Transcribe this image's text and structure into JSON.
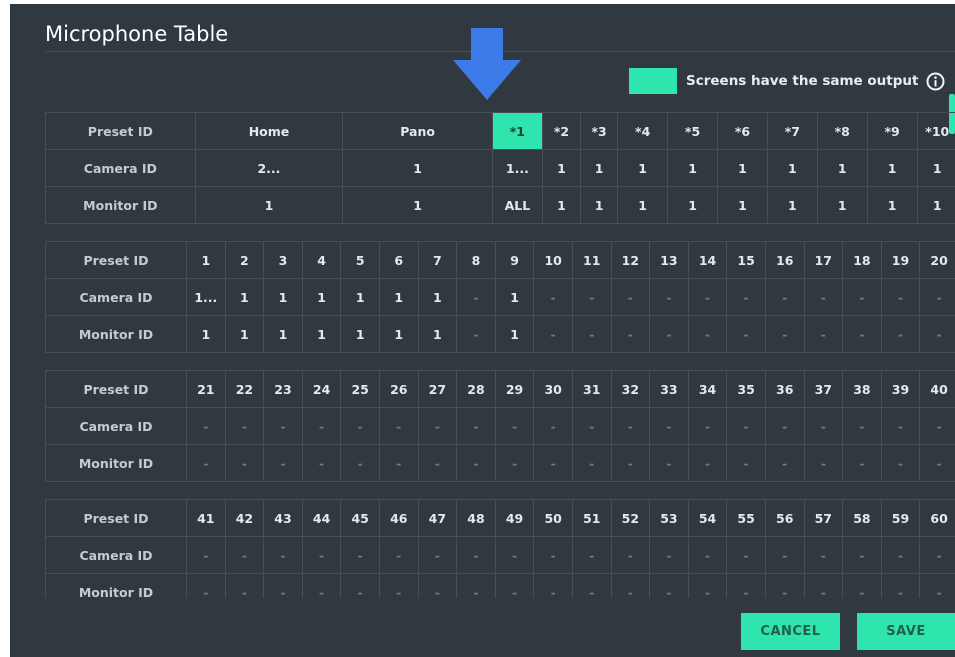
{
  "title": "Microphone Table",
  "legend": {
    "label": "Screens have the same output",
    "swatch_color": "#2ee5ad",
    "icon": "info-icon"
  },
  "colors": {
    "accent": "#2ee5ad",
    "panel": "#303840",
    "arrow": "#3d7be8"
  },
  "tables": [
    {
      "columns": 13,
      "widths": [
        1.9,
        1.88,
        1.88,
        0.62,
        0.47,
        0.47,
        0.62,
        0.62,
        0.62,
        0.62,
        0.62,
        0.62,
        0.52
      ],
      "preset": [
        "Home",
        "Pano",
        "*1",
        "*2",
        "*3",
        "*4",
        "*5",
        "*6",
        "*7",
        "*8",
        "*9",
        "*10"
      ],
      "camera": [
        "2...",
        "1",
        "1...",
        "1",
        "1",
        "1",
        "1",
        "1",
        "1",
        "1",
        "1",
        "1"
      ],
      "monitor": [
        "1",
        "1",
        "ALL",
        "1",
        "1",
        "1",
        "1",
        "1",
        "1",
        "1",
        "1",
        "1"
      ],
      "selected_index": 2
    },
    {
      "columns": 21,
      "preset": [
        "1",
        "2",
        "3",
        "4",
        "5",
        "6",
        "7",
        "8",
        "9",
        "10",
        "11",
        "12",
        "13",
        "14",
        "15",
        "16",
        "17",
        "18",
        "19",
        "20"
      ],
      "camera": [
        "1...",
        "1",
        "1",
        "1",
        "1",
        "1",
        "1",
        "-",
        "1",
        "-",
        "-",
        "-",
        "-",
        "-",
        "-",
        "-",
        "-",
        "-",
        "-",
        "-"
      ],
      "monitor": [
        "1",
        "1",
        "1",
        "1",
        "1",
        "1",
        "1",
        "-",
        "1",
        "-",
        "-",
        "-",
        "-",
        "-",
        "-",
        "-",
        "-",
        "-",
        "-",
        "-"
      ]
    },
    {
      "columns": 21,
      "preset": [
        "21",
        "22",
        "23",
        "24",
        "25",
        "26",
        "27",
        "28",
        "29",
        "30",
        "31",
        "32",
        "33",
        "34",
        "35",
        "36",
        "37",
        "38",
        "39",
        "40"
      ],
      "camera": [
        "-",
        "-",
        "-",
        "-",
        "-",
        "-",
        "-",
        "-",
        "-",
        "-",
        "-",
        "-",
        "-",
        "-",
        "-",
        "-",
        "-",
        "-",
        "-",
        "-"
      ],
      "monitor": [
        "-",
        "-",
        "-",
        "-",
        "-",
        "-",
        "-",
        "-",
        "-",
        "-",
        "-",
        "-",
        "-",
        "-",
        "-",
        "-",
        "-",
        "-",
        "-",
        "-"
      ]
    },
    {
      "columns": 21,
      "preset": [
        "41",
        "42",
        "43",
        "44",
        "45",
        "46",
        "47",
        "48",
        "49",
        "50",
        "51",
        "52",
        "53",
        "54",
        "55",
        "56",
        "57",
        "58",
        "59",
        "60"
      ],
      "camera": [
        "-",
        "-",
        "-",
        "-",
        "-",
        "-",
        "-",
        "-",
        "-",
        "-",
        "-",
        "-",
        "-",
        "-",
        "-",
        "-",
        "-",
        "-",
        "-",
        "-"
      ],
      "monitor": [
        "-",
        "-",
        "-",
        "-",
        "-",
        "-",
        "-",
        "-",
        "-",
        "-",
        "-",
        "-",
        "-",
        "-",
        "-",
        "-",
        "-",
        "-",
        "-",
        "-"
      ]
    }
  ],
  "row_labels": {
    "preset": "Preset ID",
    "camera": "Camera ID",
    "monitor": "Monitor ID"
  },
  "buttons": {
    "cancel": "CANCEL",
    "save": "SAVE"
  }
}
